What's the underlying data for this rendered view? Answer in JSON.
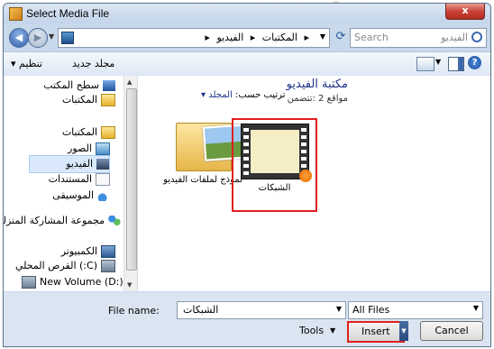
{
  "window": {
    "title": "Select Media File",
    "close_label": "x"
  },
  "address": {
    "crumbs": [
      "المكتبات",
      "الفيديو"
    ],
    "separator": "▸",
    "search_text": "Search",
    "search_placeholder": "الفيديو"
  },
  "toolbar": {
    "organize": "تنظيم ▾",
    "new_folder": "مجلد جديد",
    "help": "?"
  },
  "nav": {
    "items": [
      {
        "label": "سطح المكتب",
        "icon": "desktop-icon"
      },
      {
        "label": "المكتبات",
        "icon": "libraries-icon"
      },
      {
        "label": "المكتبات",
        "icon": "libraries-icon"
      },
      {
        "label": "الصور",
        "icon": "pictures-icon"
      },
      {
        "label": "الفيديو",
        "icon": "videos-icon",
        "selected": true
      },
      {
        "label": "المستندات",
        "icon": "documents-icon"
      },
      {
        "label": "الموسيقى",
        "icon": "music-icon"
      },
      {
        "label": "مجموعة المشاركة المنزلية",
        "icon": "homegroup-icon"
      },
      {
        "label": "الكمبيوتر",
        "icon": "computer-icon"
      },
      {
        "label": "(C:) القرص المحلي",
        "icon": "local-disk-icon"
      },
      {
        "label": "New Volume (D:)",
        "icon": "drive-icon"
      }
    ]
  },
  "content": {
    "library_title": "مكتبة الفيديو",
    "library_subtitle": "مواقع 2 :تتضمن",
    "arrange_by": "ترتيب حسب:",
    "arrange_value": "المجلد ▾",
    "files": [
      {
        "name": "نموذج لملفات الفيديو",
        "type": "folder"
      },
      {
        "name": "الشبكات",
        "type": "video",
        "selected": true
      }
    ]
  },
  "bottom": {
    "file_name_label": "File name:",
    "file_name_value": "الشبكات",
    "filter_value": "All Files",
    "tools_label": "Tools",
    "insert_label": "Insert",
    "cancel_label": "Cancel"
  },
  "colors": {
    "accent": "#1e3287",
    "highlight": "#e11f1f"
  }
}
